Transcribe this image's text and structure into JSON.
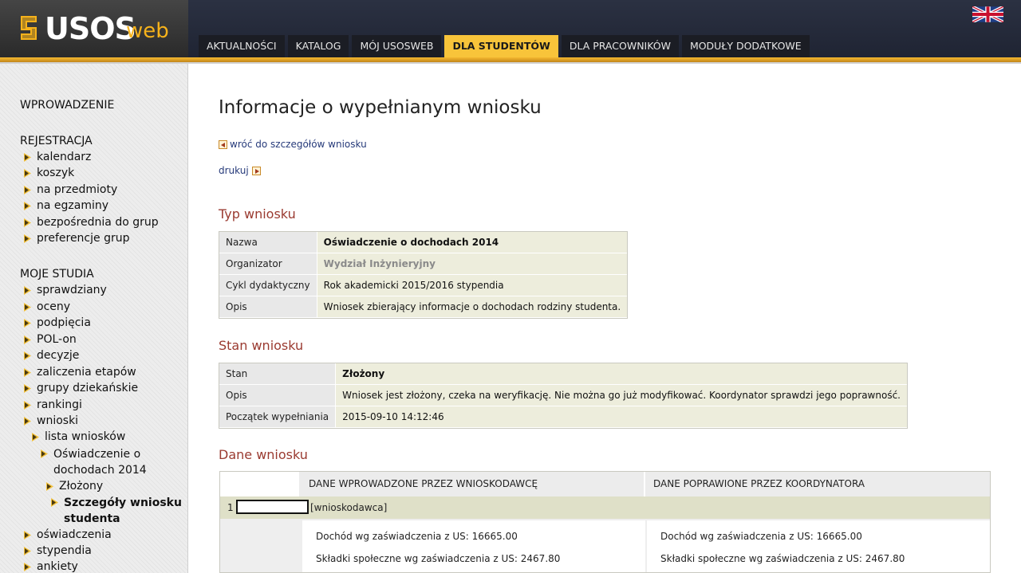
{
  "header": {
    "logo_main": "USOS",
    "logo_sub": "web",
    "tabs": [
      {
        "label": "AKTUALNOŚCI"
      },
      {
        "label": "KATALOG"
      },
      {
        "label": "MÓJ USOSWEB"
      },
      {
        "label": "DLA STUDENTÓW"
      },
      {
        "label": "DLA PRACOWNIKÓW"
      },
      {
        "label": "MODUŁY DODATKOWE"
      }
    ],
    "active_tab": "DLA STUDENTÓW",
    "accent_color": "#f8c43a"
  },
  "sidebar": {
    "wprowadzenie": "WPROWADZENIE",
    "rejestracja": "REJESTRACJA",
    "rejestracja_items": [
      "kalendarz",
      "koszyk",
      "na przedmioty",
      "na egzaminy",
      "bezpośrednia do grup",
      "preferencje grup"
    ],
    "moje_studia": "MOJE STUDIA",
    "studia_items": [
      "sprawdziany",
      "oceny",
      "podpięcia",
      "POL-on",
      "decyzje",
      "zaliczenia etapów",
      "grupy dziekańskie",
      "rankingi",
      "wnioski"
    ],
    "lista_wnioskow": "lista wniosków",
    "oswiadczenie_l1": "Oświadczenie o",
    "oswiadczenie_l2": "dochodach 2014",
    "zlozony": "Złożony",
    "szczegoly_l1": "Szczegóły wniosku",
    "szczegoly_l2": "studenta",
    "more_items": [
      "oświadczenia",
      "stypendia",
      "ankiety"
    ]
  },
  "main": {
    "title": "Informacje o wypełnianym wniosku",
    "back_link": "wróć do szczegółów wniosku",
    "print_link": "drukuj",
    "typ": {
      "heading": "Typ wniosku",
      "rows": [
        {
          "k": "Nazwa",
          "v": "Oświadczenie o dochodach 2014"
        },
        {
          "k": "Organizator",
          "v": "Wydział Inżynieryjny"
        },
        {
          "k": "Cykl dydaktyczny",
          "v": "Rok akademicki 2015/2016 stypendia"
        },
        {
          "k": "Opis",
          "v": "Wniosek zbierający informacje o dochodach rodziny studenta."
        }
      ]
    },
    "stan": {
      "heading": "Stan wniosku",
      "rows": [
        {
          "k": "Stan",
          "v": "Złożony"
        },
        {
          "k": "Opis",
          "v": "Wniosek jest złożony, czeka na weryfikację. Nie można go już modyfikować. Koordynator sprawdzi jego poprawność."
        },
        {
          "k": "Początek wypełniania",
          "v": "2015-09-10 14:12:46"
        }
      ]
    },
    "dane": {
      "heading": "Dane wniosku",
      "col_applicant": "DANE WPROWADZONE PRZEZ WNIOSKODAWCĘ",
      "col_coordinator": "DANE POPRAWIONE PRZEZ KOORDYNATORA",
      "row_num": "1",
      "row_role": "[wnioskodawca]",
      "dochod_left": "Dochód wg zaświadczenia z US: 16665.00",
      "skladki_left": "Składki społeczne wg zaświadczenia z US: 2467.80",
      "dochod_right": "Dochód wg zaświadczenia z US: 16665.00",
      "skladki_right": "Składki społeczne wg zaświadczenia z US: 2467.80"
    }
  }
}
